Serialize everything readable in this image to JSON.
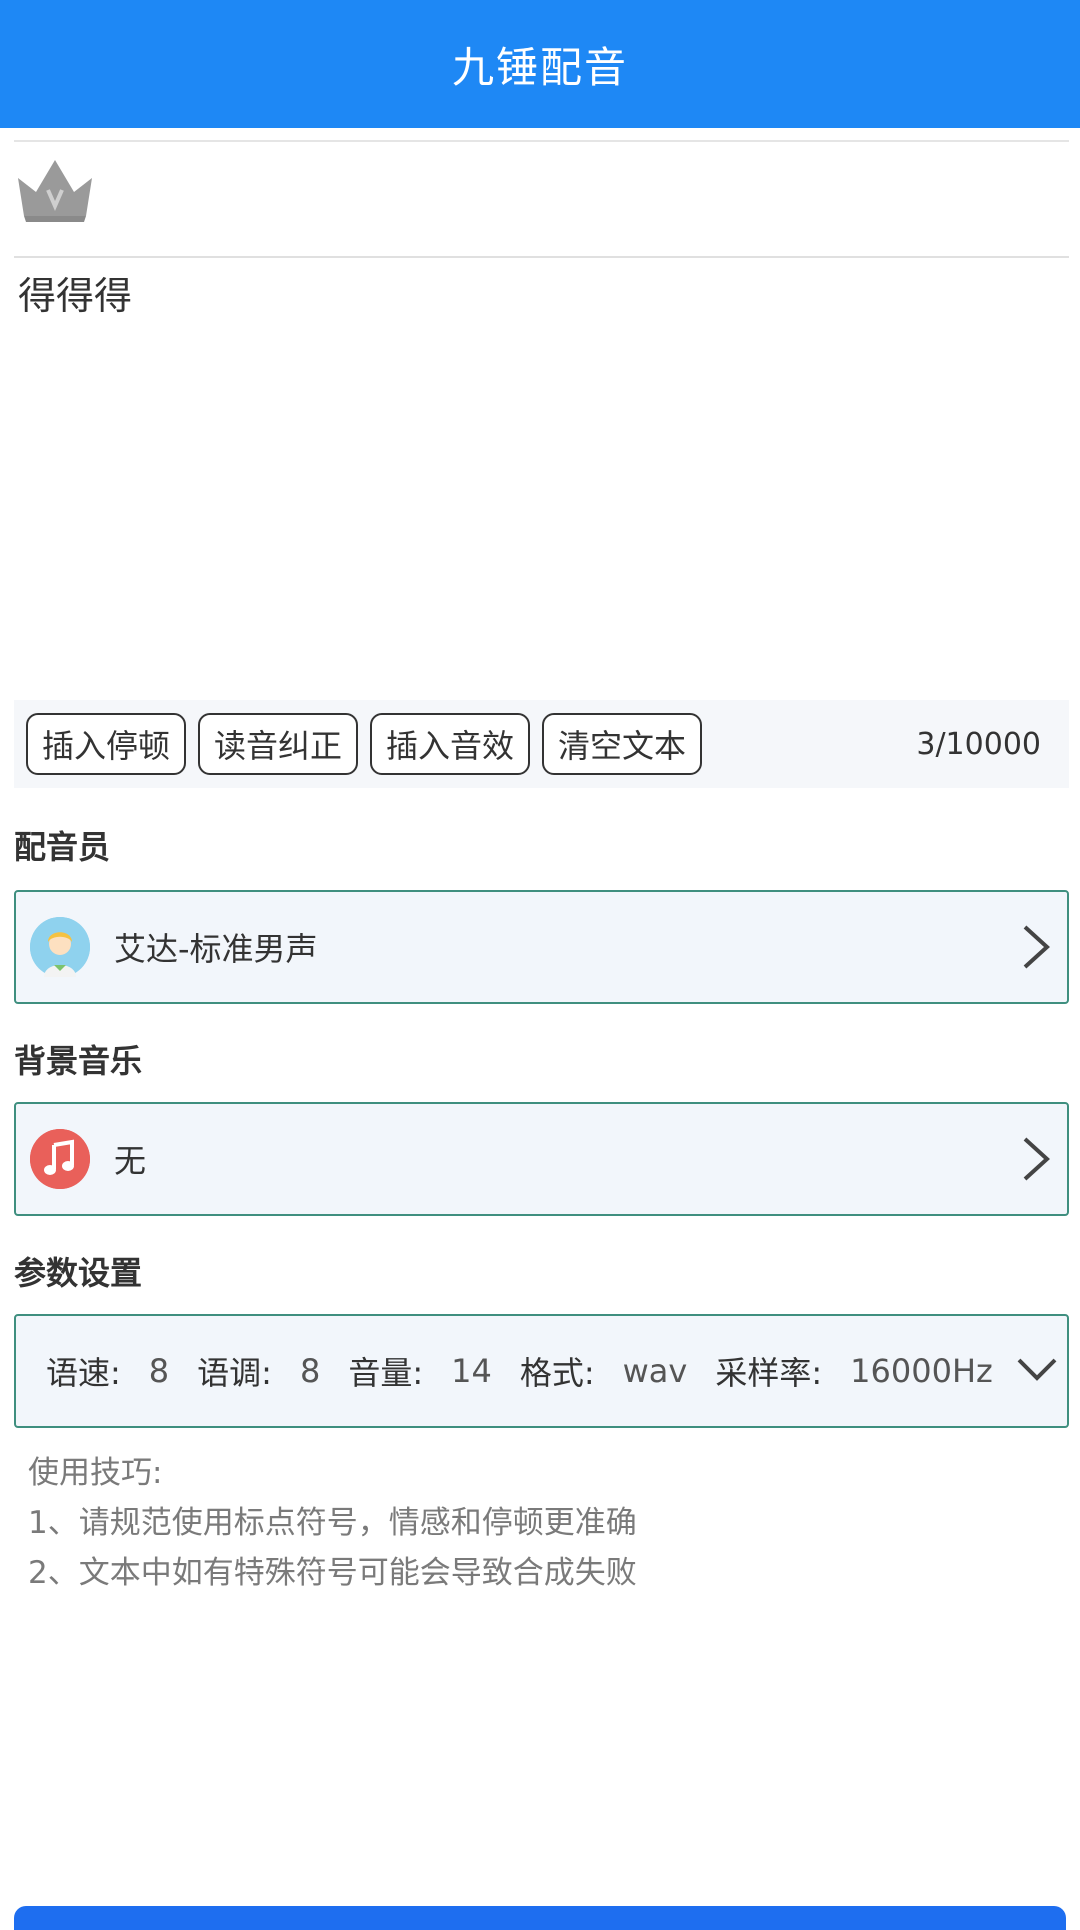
{
  "header": {
    "title": "九锤配音"
  },
  "editor": {
    "text": "得得得",
    "counter": "3/10000",
    "actions": [
      {
        "label": "插入停顿"
      },
      {
        "label": "读音纠正"
      },
      {
        "label": "插入音效"
      },
      {
        "label": "清空文本"
      }
    ]
  },
  "voice": {
    "section_label": "配音员",
    "selected": "艾达-标准男声"
  },
  "music": {
    "section_label": "背景音乐",
    "selected": "无"
  },
  "params": {
    "section_label": "参数设置",
    "speed_label": "语速:",
    "speed_value": "8",
    "pitch_label": "语调:",
    "pitch_value": "8",
    "volume_label": "音量:",
    "volume_value": "14",
    "format_label": "格式:",
    "format_value": "wav",
    "rate_label": "采样率:",
    "rate_value": "16000Hz"
  },
  "tips": {
    "title": "使用技巧:",
    "lines": [
      "1、请规范使用标点符号，情感和停顿更准确",
      "2、文本中如有特殊符号可能会导致合成失败"
    ]
  },
  "colors": {
    "brand_blue": "#1e88f5",
    "border_teal": "#3f8f7f",
    "music_red": "#e9605a"
  },
  "icons": {
    "crown": "crown-icon",
    "voice_avatar": "avatar-icon",
    "music": "music-note-icon",
    "chevron_right": "chevron-right-icon",
    "chevron_down": "chevron-down-icon"
  }
}
